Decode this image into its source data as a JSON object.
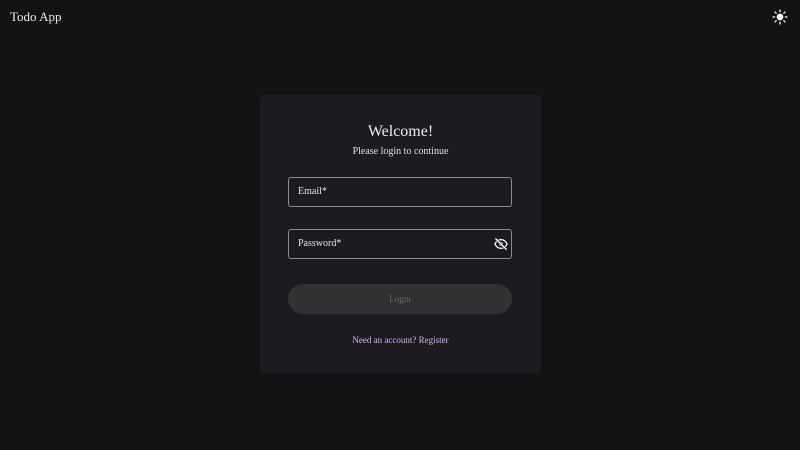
{
  "app": {
    "title": "Todo App",
    "theme_toggle_icon": "sun-icon"
  },
  "login": {
    "heading": "Welcome!",
    "subheading": "Please login to continue",
    "email_label": "Email*",
    "email_value": "",
    "password_label": "Password*",
    "password_value": "",
    "password_visibility_icon": "eye-off-icon",
    "submit_label": "Login",
    "register_link": "Need an account? Register"
  },
  "colors": {
    "background": "#141215",
    "card": "#1d1b1f",
    "button_disabled": "#323033",
    "link": "#cdb6f2"
  }
}
